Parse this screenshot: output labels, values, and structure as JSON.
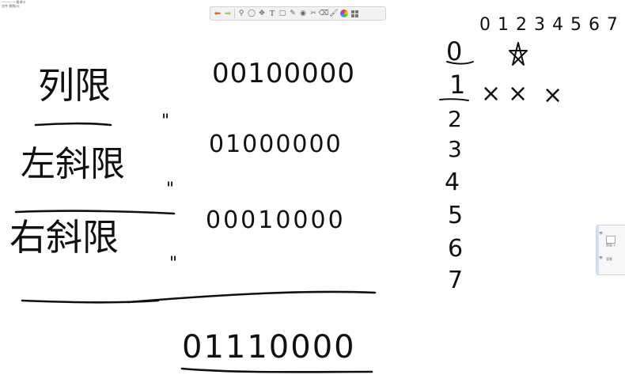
{
  "window": {
    "title_line": "一一一 ·一般讲义",
    "menu_line": "文件   视图(V)"
  },
  "toolbar": {
    "tools": [
      {
        "name": "undo-icon",
        "glyph": "⬅"
      },
      {
        "name": "redo-icon",
        "glyph": "➡"
      },
      {
        "name": "zoom-icon",
        "glyph": "⚲"
      },
      {
        "name": "lasso-icon",
        "glyph": "◯"
      },
      {
        "name": "move-icon",
        "glyph": "✥"
      },
      {
        "name": "text-tool-icon",
        "glyph": "T"
      },
      {
        "name": "note-icon",
        "glyph": "▢"
      },
      {
        "name": "pen-icon",
        "glyph": "✎"
      },
      {
        "name": "stamp-icon",
        "glyph": "◉"
      },
      {
        "name": "cut-icon",
        "glyph": "✂"
      },
      {
        "name": "eraser-icon",
        "glyph": "⌫"
      },
      {
        "name": "brush-icon",
        "glyph": "🖌"
      },
      {
        "name": "color-palette-icon",
        "glyph": ""
      },
      {
        "name": "more-icon",
        "glyph": ""
      }
    ]
  },
  "board": {
    "row1_label": "列限",
    "row1_bits": "00100000",
    "row2_label": "左斜限",
    "row2_bits": "01000000",
    "row3_label": "右斜限",
    "row3_bits": "00010000",
    "ditto_mark": "\"",
    "result_bits": "01110000",
    "column_indices": "0 1 2 3 4 5 6 7",
    "row_indices": [
      "0",
      "1",
      "2",
      "3",
      "4",
      "5",
      "6",
      "7"
    ],
    "marks": [
      "×",
      "×",
      "×"
    ]
  },
  "side_panel": {
    "item1": "图层 1",
    "item2": "背景"
  }
}
